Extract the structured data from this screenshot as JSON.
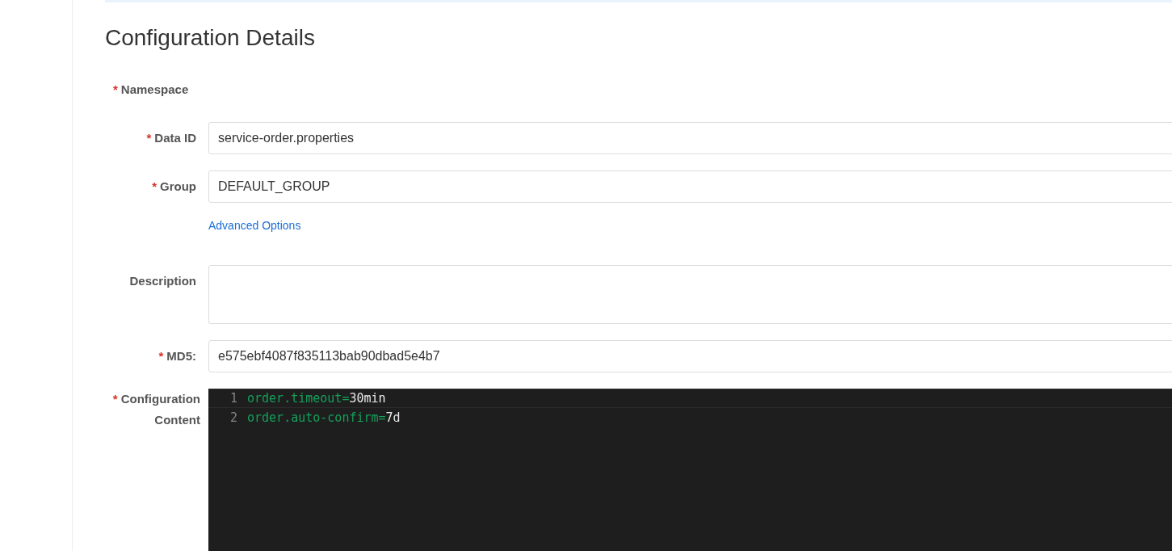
{
  "title": "Configuration Details",
  "fields": [
    {
      "kind": "none",
      "mark": "*",
      "label": "Namespace"
    },
    {
      "kind": "text",
      "mark": "*",
      "label": "Data ID",
      "value": "service-order.properties"
    },
    {
      "kind": "text",
      "mark": "*",
      "label": "Group",
      "value": "DEFAULT_GROUP"
    },
    {
      "kind": "link",
      "text": "Advanced Options"
    },
    {
      "kind": "textarea",
      "label": "Description"
    },
    {
      "kind": "text",
      "mark": "*",
      "label": "MD5:",
      "value": "e575ebf4087f835113bab90dbad5e4b7"
    },
    {
      "kind": "editor",
      "mark": "*",
      "label": "Configuration Content",
      "lines": [
        {
          "number": "1",
          "key": "order.timeout",
          "sep": "=",
          "value": "30min",
          "active": true
        },
        {
          "number": "2",
          "key": "order.auto-confirm",
          "sep": "=",
          "value": "7d",
          "active": false
        }
      ]
    }
  ]
}
